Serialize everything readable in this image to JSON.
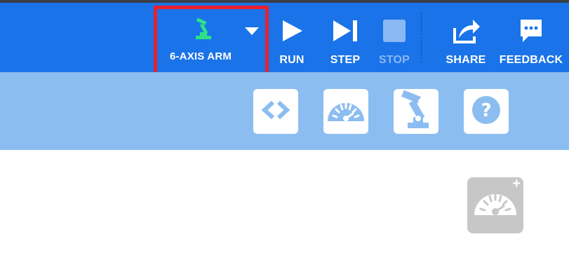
{
  "toolbar": {
    "robot_select": {
      "label": "6-AXIS ARM",
      "icon": "robot-arm-icon",
      "caret_icon": "caret-down-icon"
    },
    "run": {
      "label": "RUN",
      "icon": "play-icon"
    },
    "step": {
      "label": "STEP",
      "icon": "step-forward-icon"
    },
    "stop": {
      "label": "STOP",
      "icon": "stop-icon",
      "disabled": true
    },
    "share": {
      "label": "SHARE",
      "icon": "share-icon"
    },
    "feedback": {
      "label": "FEEDBACK",
      "icon": "feedback-icon"
    }
  },
  "subbar": {
    "buttons": [
      {
        "name": "code",
        "icon": "code-brackets-icon"
      },
      {
        "name": "gauge",
        "icon": "gauge-icon"
      },
      {
        "name": "robot",
        "icon": "robot-arm-icon"
      },
      {
        "name": "help",
        "icon": "help-icon"
      }
    ]
  },
  "workspace": {
    "add_gauge": {
      "icon": "gauge-add-icon",
      "plus": "+"
    }
  },
  "colors": {
    "toolbar_bg": "#1a73e8",
    "subbar_bg": "#8cbdf1",
    "robot_icon": "#2ee08a",
    "highlight_border": "#e8212d",
    "disabled": "#8ab8f5",
    "add_gauge_bg": "#c7c7c7"
  }
}
